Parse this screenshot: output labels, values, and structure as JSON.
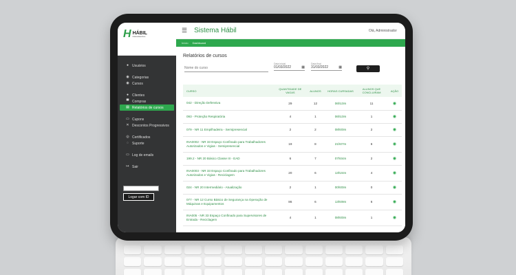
{
  "brand": {
    "logo_mark": "H",
    "logo_text": "HÁBIL",
    "logo_sub": "treinamentos"
  },
  "header": {
    "title": "Sistema Hábil",
    "user": "Olá, Administrador",
    "menu_icon": "hamburger-icon"
  },
  "breadcrumb": [
    "Início",
    "Dashboard"
  ],
  "sidebar": {
    "groups": [
      [
        {
          "label": "Usuários",
          "icon": "user-icon"
        }
      ],
      [
        {
          "label": "Categorias",
          "icon": "tag-icon"
        },
        {
          "label": "Cursos",
          "icon": "book-icon"
        }
      ],
      [
        {
          "label": "Clientes",
          "icon": "users-icon"
        },
        {
          "label": "Compras",
          "icon": "cart-icon"
        },
        {
          "label": "Relatórios de cursos",
          "icon": "report-icon",
          "active": true
        }
      ],
      [
        {
          "label": "Cupons",
          "icon": "ticket-icon"
        },
        {
          "label": "Descontos Progressivos",
          "icon": "discount-icon"
        }
      ],
      [
        {
          "label": "Certificados",
          "icon": "certificate-icon"
        },
        {
          "label": "Suporte",
          "icon": "support-icon"
        }
      ],
      [
        {
          "label": "Log de emails",
          "icon": "mail-icon"
        }
      ],
      [
        {
          "label": "Sair",
          "icon": "logout-icon"
        }
      ]
    ],
    "login_input_value": "",
    "login_button": "Logar com ID"
  },
  "page": {
    "title": "Relatórios de cursos",
    "filters": {
      "name_placeholder": "Nome do curso",
      "start_label": "Data inicial",
      "start_value": "01/03/2022",
      "end_label": "Data final",
      "end_value": "31/03/2022",
      "search_icon": "search-icon"
    }
  },
  "table": {
    "headers": [
      "CURSO",
      "QUANTIDADE DE VAGAS",
      "ALUNOS",
      "HORAS CURSADAS",
      "ALUNOS QUE CONCLUIRAM",
      "AÇÃO"
    ],
    "rows": [
      {
        "curso": "042 - Direção Defensiva",
        "vagas": "29",
        "alunos": "12",
        "horas": "06h10m",
        "concluiram": "11"
      },
      {
        "curso": "093 - Proteção Respiratória",
        "vagas": "4",
        "alunos": "1",
        "horas": "06h10m",
        "concluiram": "1"
      },
      {
        "curso": "079 - NR 11 Empilhadeira - Semipresencial",
        "vagas": "2",
        "alunos": "2",
        "horas": "08h00m",
        "concluiram": "2"
      },
      {
        "curso": "INA0002 - NR 33 Espaço Confinado para Trabalhadores Autorizados e Vigias - Semipresencial",
        "vagas": "19",
        "alunos": "8",
        "horas": "21h07m",
        "concluiram": "6"
      },
      {
        "curso": "199.2 - NR 20 Básico Classe III - EAD",
        "vagas": "6",
        "alunos": "7",
        "horas": "07h04m",
        "concluiram": "2"
      },
      {
        "curso": "INA0003 - NR 33 Espaço Confinado para Trabalhadores Autorizados e Vigias - Reciclagem",
        "vagas": "20",
        "alunos": "6",
        "horas": "13h24m",
        "concluiram": "4"
      },
      {
        "curso": "024 - NR 20 Intermediário - Atualização",
        "vagas": "2",
        "alunos": "1",
        "horas": "00h00m",
        "concluiram": "0"
      },
      {
        "curso": "077 - NR 12 Curso Básico de Segurança na Operação de Máquinas e Equipamentos",
        "vagas": "86",
        "alunos": "6",
        "horas": "13h09m",
        "concluiram": "6"
      },
      {
        "curso": "INA005 - NR 33 Espaço Confinado para Supervisores de Entrada - Reciclagem",
        "vagas": "4",
        "alunos": "1",
        "horas": "08h00m",
        "concluiram": "1"
      }
    ],
    "action_icon": "eye-icon"
  }
}
